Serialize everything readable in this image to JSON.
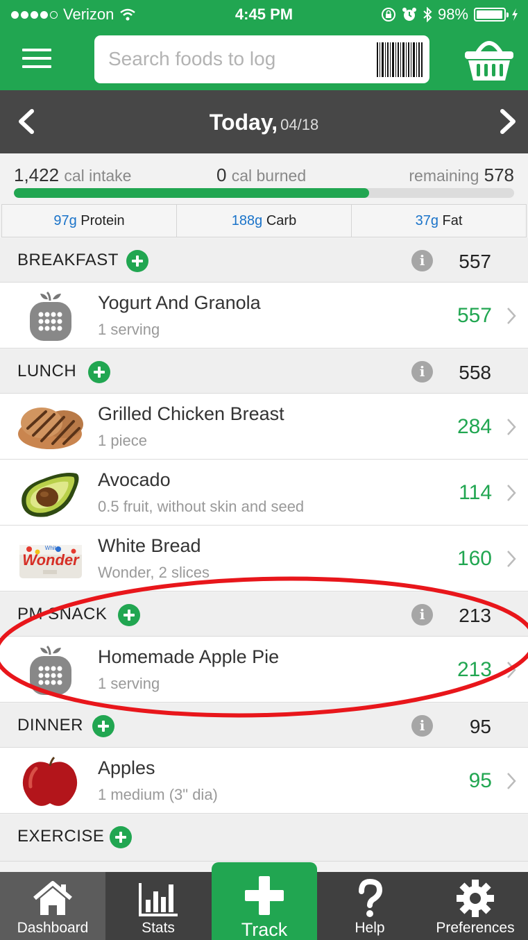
{
  "status_bar": {
    "carrier": "Verizon",
    "time": "4:45 PM",
    "battery": "98%",
    "battery_level": 0.98
  },
  "header": {
    "search_placeholder": "Search foods to log"
  },
  "date_bar": {
    "today_label": "Today,",
    "date": "04/18"
  },
  "summary": {
    "intake_value": "1,422",
    "intake_label": "cal intake",
    "burned_value": "0",
    "burned_label": "cal burned",
    "remaining_label": "remaining",
    "remaining_value": "578",
    "progress_fraction": 0.71
  },
  "macros": [
    {
      "value": "97g",
      "label": "Protein"
    },
    {
      "value": "188g",
      "label": "Carb"
    },
    {
      "value": "37g",
      "label": "Fat"
    }
  ],
  "meals": {
    "breakfast": {
      "title": "BREAKFAST",
      "total": "557",
      "items": [
        {
          "name": "Yogurt And Granola",
          "desc": "1 serving",
          "cal": "557",
          "icon": "generic-food-icon"
        }
      ]
    },
    "lunch": {
      "title": "LUNCH",
      "total": "558",
      "items": [
        {
          "name": "Grilled Chicken Breast",
          "desc": "1 piece",
          "cal": "284",
          "icon": "chicken-image"
        },
        {
          "name": "Avocado",
          "desc": "0.5 fruit, without skin and seed",
          "cal": "114",
          "icon": "avocado-image"
        },
        {
          "name": "White Bread",
          "desc": "Wonder, 2 slices",
          "cal": "160",
          "icon": "bread-image",
          "brand_text": "Wonder",
          "brand_sub": "White"
        }
      ]
    },
    "pm_snack": {
      "title": "PM SNACK",
      "total": "213",
      "items": [
        {
          "name": "Homemade Apple Pie",
          "desc": "1 serving",
          "cal": "213",
          "icon": "generic-food-icon"
        }
      ]
    },
    "dinner": {
      "title": "DINNER",
      "total": "95",
      "items": [
        {
          "name": "Apples",
          "desc": "1 medium (3\" dia)",
          "cal": "95",
          "icon": "apple-image"
        }
      ]
    },
    "exercise": {
      "title": "EXERCISE"
    }
  },
  "nav": {
    "tabs": [
      {
        "label": "Dashboard",
        "icon": "home-icon"
      },
      {
        "label": "Stats",
        "icon": "bar-chart-icon"
      },
      {
        "label": "Track",
        "icon": "plus-icon"
      },
      {
        "label": "Help",
        "icon": "question-icon"
      },
      {
        "label": "Preferences",
        "icon": "gear-icon"
      }
    ]
  },
  "colors": {
    "brand_green": "#21a651",
    "dark_bar": "#474747",
    "macro_blue": "#1a73c9",
    "highlight_red": "#e8161b"
  }
}
